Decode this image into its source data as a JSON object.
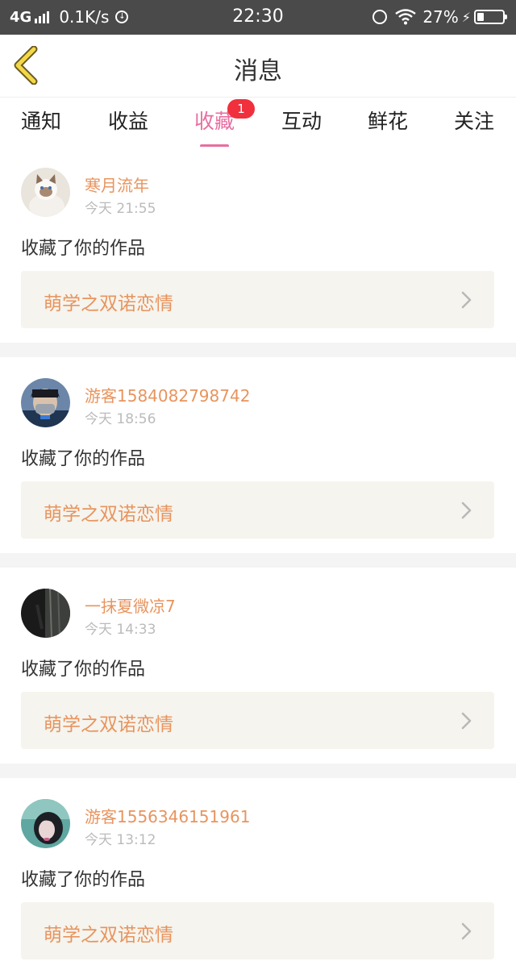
{
  "status_bar": {
    "network": "4G",
    "speed": "0.1K/s",
    "time": "22:30",
    "battery": "27%",
    "battery_level": 0.27,
    "icons": [
      "signal-icon",
      "data-saver-icon",
      "alarm-icon",
      "wifi-icon",
      "charging-icon",
      "battery-icon"
    ]
  },
  "nav": {
    "title": "消息",
    "back_icon": "chevron-left-icon"
  },
  "tabs": [
    {
      "label": "通知",
      "active": false
    },
    {
      "label": "收益",
      "active": false
    },
    {
      "label": "收藏",
      "active": true,
      "badge": "1"
    },
    {
      "label": "互动",
      "active": false
    },
    {
      "label": "鲜花",
      "active": false
    },
    {
      "label": "关注",
      "active": false
    }
  ],
  "colors": {
    "accent_pink": "#e86ea0",
    "name_orange": "#e8945e",
    "badge_red": "#f0303c"
  },
  "messages": [
    {
      "user": "寒月流年",
      "time": "今天 21:55",
      "action": "收藏了你的作品",
      "work_title": "萌学之双诺恋情",
      "avatar": "cat-avatar"
    },
    {
      "user": "游客1584082798742",
      "time": "今天 18:56",
      "action": "收藏了你的作品",
      "work_title": "萌学之双诺恋情",
      "avatar": "masked-boy-avatar"
    },
    {
      "user": "一抹夏微凉7",
      "time": "今天 14:33",
      "action": "收藏了你的作品",
      "work_title": "萌学之双诺恋情",
      "avatar": "dark-window-avatar"
    },
    {
      "user": "游客1556346151961",
      "time": "今天 13:12",
      "action": "收藏了你的作品",
      "work_title": "萌学之双诺恋情",
      "avatar": "girl-avatar"
    }
  ]
}
